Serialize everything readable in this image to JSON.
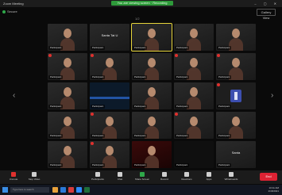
{
  "window": {
    "app_title": "Zoom Meeting",
    "recording_banner": "You are viewing screen · Recording",
    "window_buttons": "– ▢ ✕"
  },
  "meeting": {
    "security_label": "Secure",
    "view_label": "Gallery View",
    "page_indicator": "1/2"
  },
  "tiles": [
    {
      "name": "Participant",
      "kind": "video"
    },
    {
      "name": "Participant",
      "kind": "name",
      "big": "Santa Tat U"
    },
    {
      "name": "Participant",
      "kind": "video",
      "active": true
    },
    {
      "name": "Participant",
      "kind": "video"
    },
    {
      "name": "Participant",
      "kind": "video"
    },
    {
      "name": "Participant",
      "kind": "video",
      "muted": true
    },
    {
      "name": "Participant",
      "kind": "video",
      "muted": true
    },
    {
      "name": "Participant",
      "kind": "video"
    },
    {
      "name": "Participant",
      "kind": "video",
      "muted": true
    },
    {
      "name": "Participant",
      "kind": "video",
      "muted": true
    },
    {
      "name": "Participant",
      "kind": "video"
    },
    {
      "name": "Participant",
      "kind": "screen"
    },
    {
      "name": "Participant",
      "kind": "video"
    },
    {
      "name": "Participant",
      "kind": "video"
    },
    {
      "name": "Participant",
      "kind": "avatar",
      "muted": true
    },
    {
      "name": "Participant",
      "kind": "video"
    },
    {
      "name": "Participant",
      "kind": "video",
      "muted": true
    },
    {
      "name": "Participant",
      "kind": "video"
    },
    {
      "name": "Participant",
      "kind": "video",
      "muted": true
    },
    {
      "name": "Participant",
      "kind": "video"
    },
    {
      "name": "Participant",
      "kind": "video"
    },
    {
      "name": "Participant",
      "kind": "video",
      "muted": true
    },
    {
      "name": "Participant",
      "kind": "red"
    },
    {
      "name": "Participant",
      "kind": "blank"
    },
    {
      "name": "Participant",
      "kind": "name",
      "big": "Santa"
    }
  ],
  "controls": {
    "unmute": "Unmute",
    "stop_video": "Stop Video",
    "participants": "Participants",
    "chat": "Chat",
    "share_screen": "Share Screen",
    "record": "Record",
    "reactions": "Reactions",
    "apps": "Apps",
    "whiteboards": "Whiteboards",
    "end": "End"
  },
  "taskbar": {
    "search_placeholder": "Type here to search",
    "time": "10:11 AM",
    "date": "2/18/2021"
  },
  "colors": {
    "mute_red": "#e0312e",
    "active_outline": "#e6d43a",
    "recording_green": "#2e9a3a"
  }
}
